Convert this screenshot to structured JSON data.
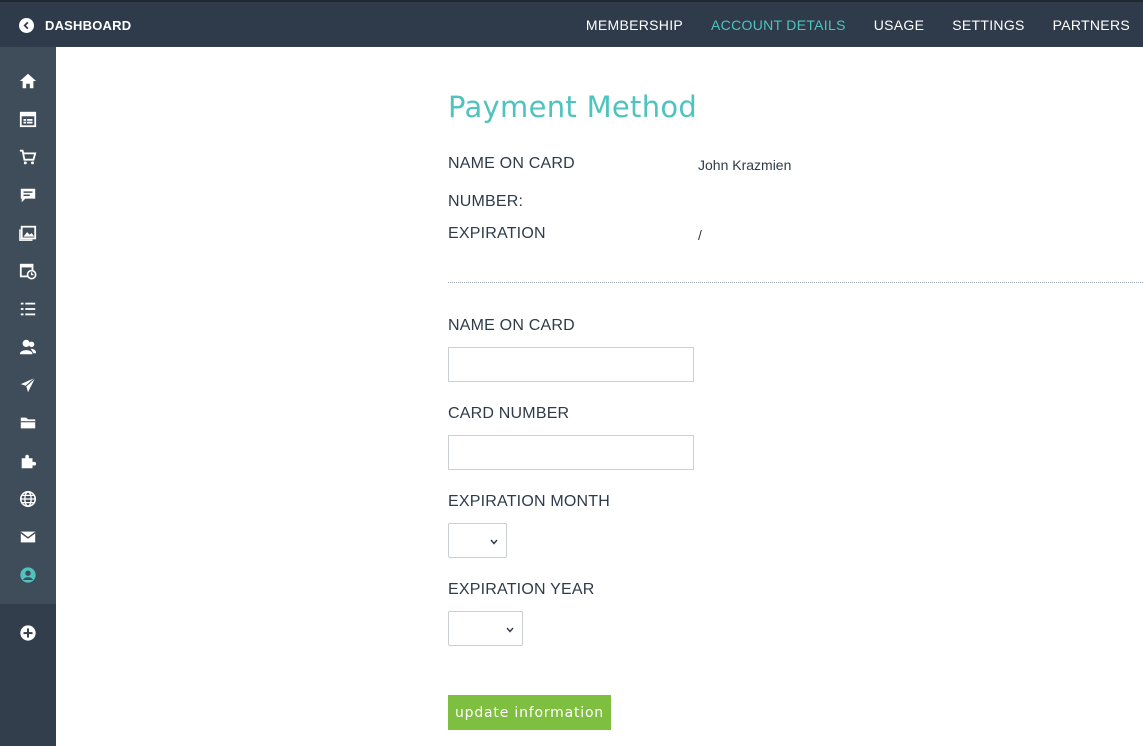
{
  "topbar": {
    "back_label": "DASHBOARD",
    "nav": [
      {
        "label": "MEMBERSHIP",
        "active": false
      },
      {
        "label": "ACCOUNT DETAILS",
        "active": true
      },
      {
        "label": "USAGE",
        "active": false
      },
      {
        "label": "SETTINGS",
        "active": false
      },
      {
        "label": "PARTNERS",
        "active": false
      }
    ]
  },
  "sidebar": {
    "icons": [
      "home-icon",
      "calendar-icon",
      "cart-icon",
      "chat-icon",
      "gallery-icon",
      "schedule-icon",
      "list-icon",
      "users-icon",
      "send-icon",
      "folder-icon",
      "puzzle-icon",
      "globe-icon",
      "mail-icon",
      "account-icon",
      "add-icon"
    ],
    "active_icon": "account-icon"
  },
  "payment": {
    "title": "Payment Method",
    "name_label": "NAME ON CARD",
    "name_value": "John Krazmien",
    "number_label": "NUMBER:",
    "number_value": "",
    "expiration_label": "EXPIRATION",
    "expiration_value": "/"
  },
  "form": {
    "name_label": "NAME ON CARD",
    "name_value": "",
    "card_label": "CARD NUMBER",
    "card_value": "",
    "month_label": "EXPIRATION MONTH",
    "month_value": "",
    "year_label": "EXPIRATION YEAR",
    "year_value": "",
    "submit_label": "update information"
  },
  "colors": {
    "accent": "#4fc3be",
    "topbar": "#2f3b4a",
    "sidebar": "#3f4c5a",
    "button": "#7fbf3f"
  }
}
